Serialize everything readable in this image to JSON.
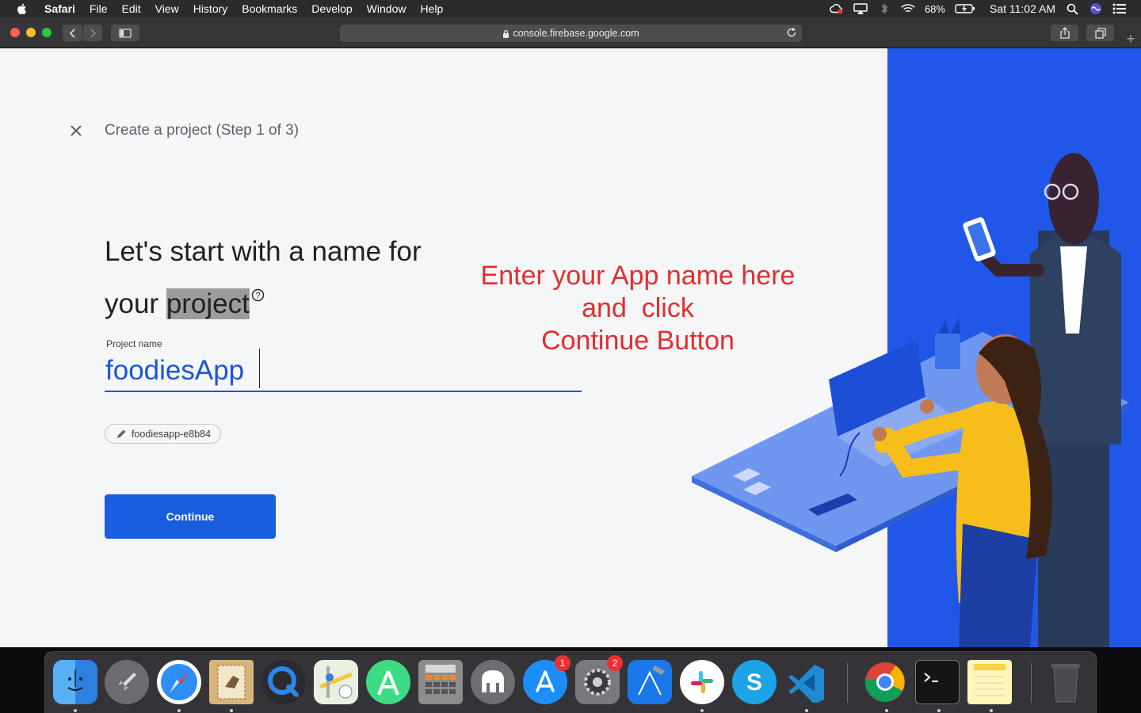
{
  "menubar": {
    "app_name": "Safari",
    "items": [
      "File",
      "Edit",
      "View",
      "History",
      "Bookmarks",
      "Develop",
      "Window",
      "Help"
    ],
    "battery": "68%",
    "clock": "Sat 11:02 AM",
    "icons": [
      "creative-cloud-icon",
      "airplay-icon",
      "bluetooth-icon",
      "wifi-icon",
      "battery-icon",
      "spotlight-search-icon",
      "siri-icon",
      "notification-center-icon"
    ]
  },
  "browser": {
    "url": "console.firebase.google.com",
    "new_tab": "+"
  },
  "page": {
    "step_title": "Create a project (Step 1 of 3)",
    "headline_start": "Let's start with a name for your ",
    "headline_highlight": "project",
    "help_symbol": "?",
    "project_name_label": "Project name",
    "project_name_value": "foodiesApp",
    "project_id_chip": "foodiesapp-e8b84",
    "continue_label": "Continue"
  },
  "annotation": {
    "color": "#e32d2d",
    "lines": [
      "Enter your App name here",
      "and  click",
      "Continue Button"
    ]
  },
  "dock": {
    "apps": [
      {
        "name": "Finder"
      },
      {
        "name": "Launchpad"
      },
      {
        "name": "Safari"
      },
      {
        "name": "Mail"
      },
      {
        "name": "QuickTime Player"
      },
      {
        "name": "Maps"
      },
      {
        "name": "Android Studio"
      },
      {
        "name": "Calculator"
      },
      {
        "name": "TablePlus"
      },
      {
        "name": "App Store",
        "badge": "1"
      },
      {
        "name": "System Preferences",
        "badge": "2"
      },
      {
        "name": "Xcode"
      },
      {
        "name": "Slack"
      },
      {
        "name": "Skype"
      },
      {
        "name": "Visual Studio Code"
      },
      {
        "name": "Google Chrome"
      },
      {
        "name": "Terminal"
      },
      {
        "name": "Notes"
      },
      {
        "name": "Trash"
      }
    ]
  },
  "colors": {
    "accent": "#1a5ee0",
    "illustration_blue": "#2157e8",
    "page_bg": "#f5f6f8"
  }
}
